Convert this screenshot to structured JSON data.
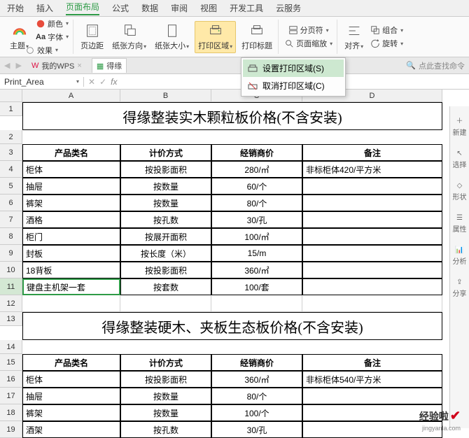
{
  "ribbon_tabs": [
    "开始",
    "插入",
    "页面布局",
    "公式",
    "数据",
    "审阅",
    "视图",
    "开发工具",
    "云服务"
  ],
  "ribbon_active": "页面布局",
  "ribbon": {
    "theme": "主题",
    "color": "颜色",
    "font": "字体",
    "effect": "效果",
    "margins": "页边距",
    "orientation": "纸张方向",
    "size": "纸张大小",
    "print_area": "打印区域",
    "print_titles": "打印标题",
    "page_break": "分页符",
    "page_zoom": "页面缩放",
    "align": "对齐",
    "rotate": "旋转",
    "group": "组合"
  },
  "dropdown": {
    "set": "设置打印区域(S)",
    "cancel": "取消打印区域(C)"
  },
  "doc_tabs": {
    "my_wps": "我的WPS",
    "file": "得缘"
  },
  "search_hint": "点此查找命令",
  "name_box": "Print_Area",
  "fx": "fx",
  "columns": [
    "A",
    "B",
    "C",
    "D"
  ],
  "rows": [
    "1",
    "2",
    "3",
    "4",
    "5",
    "6",
    "7",
    "8",
    "9",
    "10",
    "11",
    "12",
    "13",
    "14",
    "15",
    "16",
    "17",
    "18",
    "19"
  ],
  "table1": {
    "title": "得缘整装实木颗粒板价格(不含安装)",
    "headers": [
      "产品类名",
      "计价方式",
      "经销商价",
      "备注"
    ],
    "rows": [
      [
        "柜体",
        "按投影面积",
        "280/㎡",
        "非标柜体420/平方米"
      ],
      [
        "抽屉",
        "按数量",
        "60/个",
        ""
      ],
      [
        "裤架",
        "按数量",
        "80/个",
        ""
      ],
      [
        "酒格",
        "按孔数",
        "30/孔",
        ""
      ],
      [
        "柜门",
        "按展开面积",
        "100/㎡",
        ""
      ],
      [
        "封板",
        "按长度（米）",
        "15/m",
        ""
      ],
      [
        "18背板",
        "按投影面积",
        "360/㎡",
        ""
      ],
      [
        "键盘主机架一套",
        "按套数",
        "100/套",
        ""
      ]
    ]
  },
  "table2": {
    "title": "得缘整装硬木、夹板生态板价格(不含安装)",
    "headers": [
      "产品类名",
      "计价方式",
      "经销商价",
      "备注"
    ],
    "rows": [
      [
        "柜体",
        "按投影面积",
        "360/㎡",
        "非标柜体540/平方米"
      ],
      [
        "抽屉",
        "按数量",
        "80/个",
        ""
      ],
      [
        "裤架",
        "按数量",
        "100/个",
        ""
      ],
      [
        "酒架",
        "按孔数",
        "30/孔",
        ""
      ]
    ]
  },
  "side": {
    "new": "新建",
    "select": "选择",
    "format": "形状",
    "attr": "属性",
    "analyze": "分析",
    "share": "分享"
  },
  "watermark": {
    "text": "经验啦",
    "url": "jingyanla.com"
  }
}
